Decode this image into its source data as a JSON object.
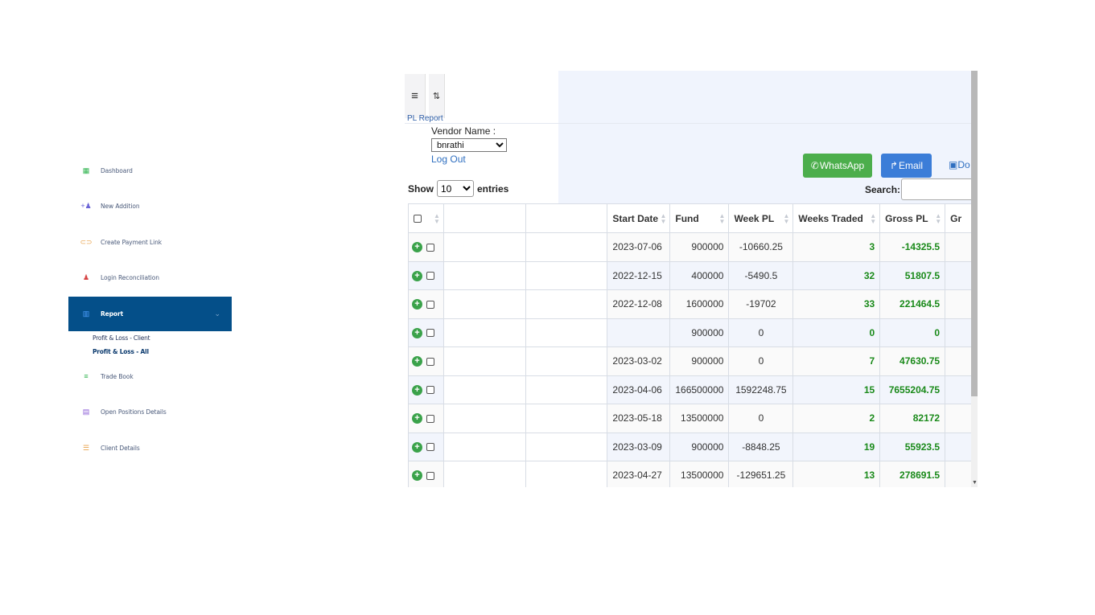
{
  "sidebar": {
    "items": [
      {
        "label": "Dashboard",
        "icon": "dashboard-icon",
        "color": "#2ab24a",
        "glyph": "▦"
      },
      {
        "label": "New Addition",
        "icon": "add-user-icon",
        "color": "#6a63d6",
        "glyph": "+"
      },
      {
        "label": "Create Payment Link",
        "icon": "payment-link-icon",
        "color": "#e8a24a",
        "glyph": "⊂⊃"
      },
      {
        "label": "Login Reconciliation",
        "icon": "user-icon",
        "color": "#d64545",
        "glyph": "♟"
      },
      {
        "label": "Report",
        "icon": "chart-icon",
        "color": "#4ea0ff",
        "glyph": "▥"
      },
      {
        "label": "Trade Book",
        "icon": "list-icon",
        "color": "#2ab24a",
        "glyph": "≡"
      },
      {
        "label": "Open Positions Details",
        "icon": "document-icon",
        "color": "#8a5ad6",
        "glyph": "▤"
      },
      {
        "label": "Client Details",
        "icon": "client-list-icon",
        "color": "#e8a24a",
        "glyph": "☰"
      }
    ],
    "report_chevron": "⌄",
    "sub_items": [
      "Profit & Loss - Client",
      "Profit & Loss - All"
    ]
  },
  "toolbar": {
    "menu_glyph": "≡",
    "sort_glyph": "⇅"
  },
  "breadcrumb": "PL Report",
  "vendor": {
    "label": "Vendor Name :",
    "selected": "bnrathi"
  },
  "logout": "Log Out",
  "buttons": {
    "whatsapp": "WhatsApp",
    "email": "Email",
    "download": "Do"
  },
  "entries": {
    "show": "Show",
    "value": "10",
    "suffix": "entries"
  },
  "search": {
    "label": "Search:"
  },
  "table": {
    "headers": [
      "Start Date",
      "Fund",
      "Week PL",
      "Weeks Traded",
      "Gross PL",
      "Gr"
    ],
    "rows": [
      {
        "start_date": "2023-07-06",
        "fund": "900000",
        "week_pl": "-10660.25",
        "weeks_traded": "3",
        "gross_pl": "-14325.5"
      },
      {
        "start_date": "2022-12-15",
        "fund": "400000",
        "week_pl": "-5490.5",
        "weeks_traded": "32",
        "gross_pl": "51807.5"
      },
      {
        "start_date": "2022-12-08",
        "fund": "1600000",
        "week_pl": "-19702",
        "weeks_traded": "33",
        "gross_pl": "221464.5"
      },
      {
        "start_date": "",
        "fund": "900000",
        "week_pl": "0",
        "weeks_traded": "0",
        "gross_pl": "0"
      },
      {
        "start_date": "2023-03-02",
        "fund": "900000",
        "week_pl": "0",
        "weeks_traded": "7",
        "gross_pl": "47630.75"
      },
      {
        "start_date": "2023-04-06",
        "fund": "166500000",
        "week_pl": "1592248.75",
        "weeks_traded": "15",
        "gross_pl": "7655204.75"
      },
      {
        "start_date": "2023-05-18",
        "fund": "13500000",
        "week_pl": "0",
        "weeks_traded": "2",
        "gross_pl": "82172"
      },
      {
        "start_date": "2023-03-09",
        "fund": "900000",
        "week_pl": "-8848.25",
        "weeks_traded": "19",
        "gross_pl": "55923.5"
      },
      {
        "start_date": "2023-04-27",
        "fund": "13500000",
        "week_pl": "-129651.25",
        "weeks_traded": "13",
        "gross_pl": "278691.5"
      }
    ]
  },
  "colors": {
    "accent": "#044f89",
    "positive": "#1a8a1a",
    "whatsapp": "#4cae4c",
    "email": "#3b7dd8",
    "band": "#f0f4fd"
  }
}
